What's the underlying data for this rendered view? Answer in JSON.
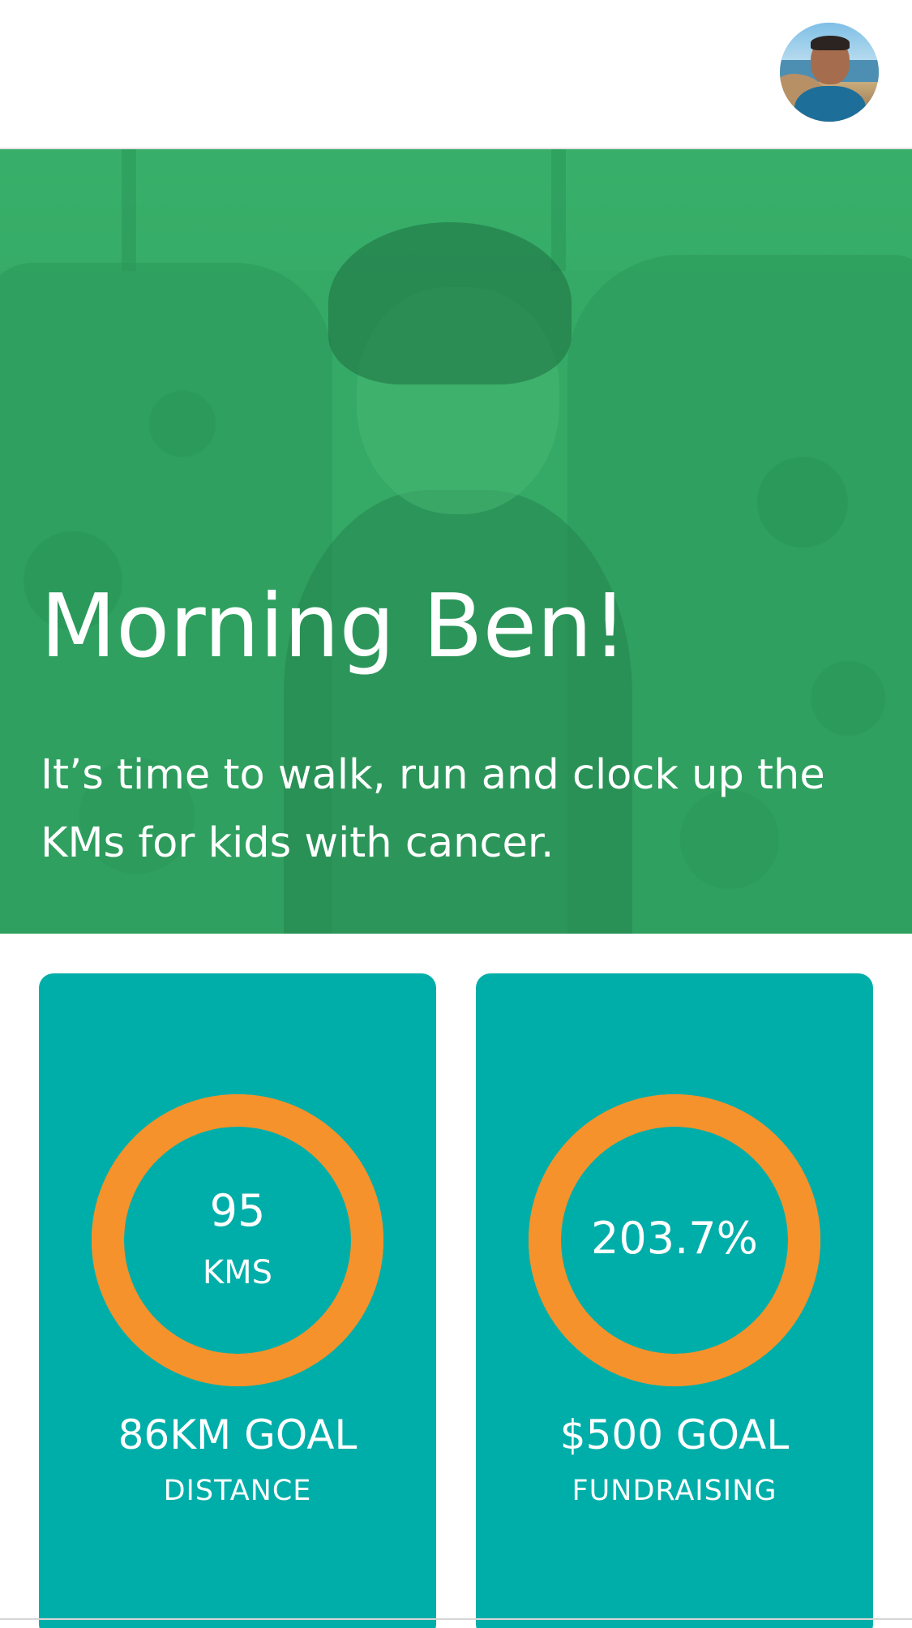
{
  "header": {
    "avatar_icon": "user-avatar"
  },
  "hero": {
    "title": "Morning Ben!",
    "subtitle": "It’s time to walk, run and clock up the KMs for kids with cancer.",
    "overlay_color": "#36aa68"
  },
  "cards": {
    "distance": {
      "value": "95",
      "unit": "KMS",
      "goal": "86KM GOAL",
      "label": "DISTANCE",
      "progress_fraction": 1.0
    },
    "fundraising": {
      "value": "203.7%",
      "goal": "$500 GOAL",
      "label": "FUNDRAISING",
      "progress_fraction": 1.0
    }
  },
  "colors": {
    "card_bg": "#00aea9",
    "ring": "#f5922b",
    "hero_green": "#36aa68"
  }
}
